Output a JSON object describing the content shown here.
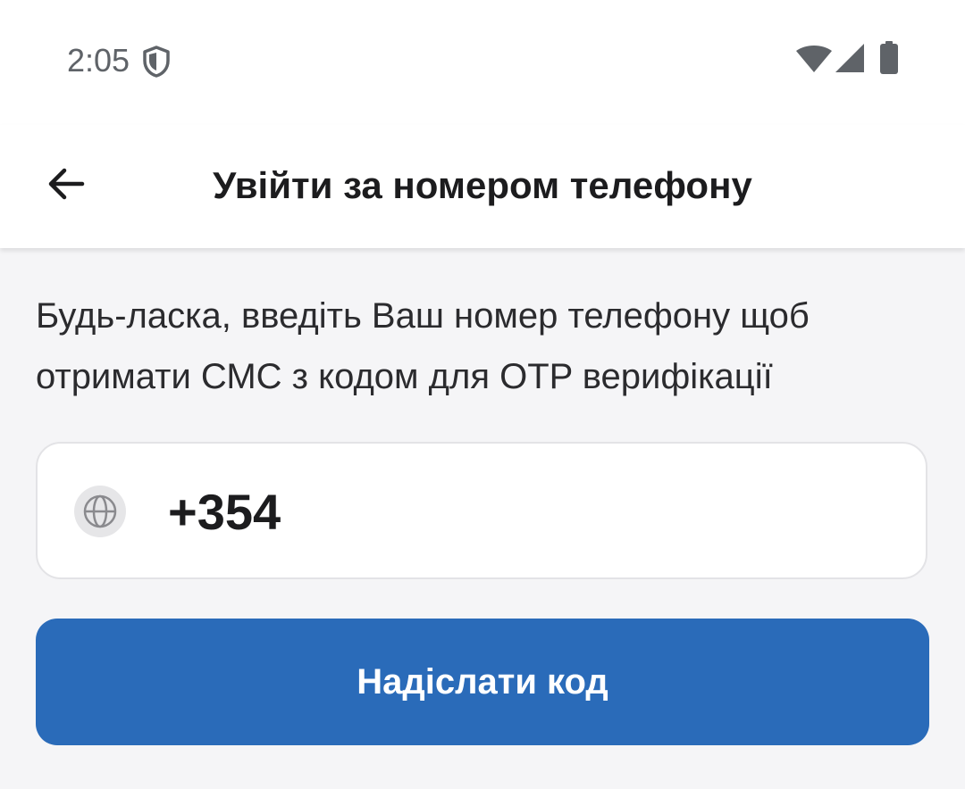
{
  "status_bar": {
    "time": "2:05",
    "icons": [
      "shield-icon",
      "wifi-icon",
      "signal-icon",
      "battery-icon"
    ]
  },
  "app_bar": {
    "title": "Увійти за номером телефону",
    "back_icon": "arrow-back-icon"
  },
  "main": {
    "instruction": "Будь-ласка, введіть Ваш номер телефону щоб отримати СМС з кодом для OTP верифікації",
    "phone": {
      "country_icon": "globe-icon",
      "value": "+354"
    },
    "send_button_label": "Надіслати код"
  },
  "colors": {
    "accent": "#2a6bb9",
    "background": "#f5f5f7",
    "surface": "#ffffff",
    "text_primary": "#1c1c1e",
    "status_text": "#5f6368"
  }
}
